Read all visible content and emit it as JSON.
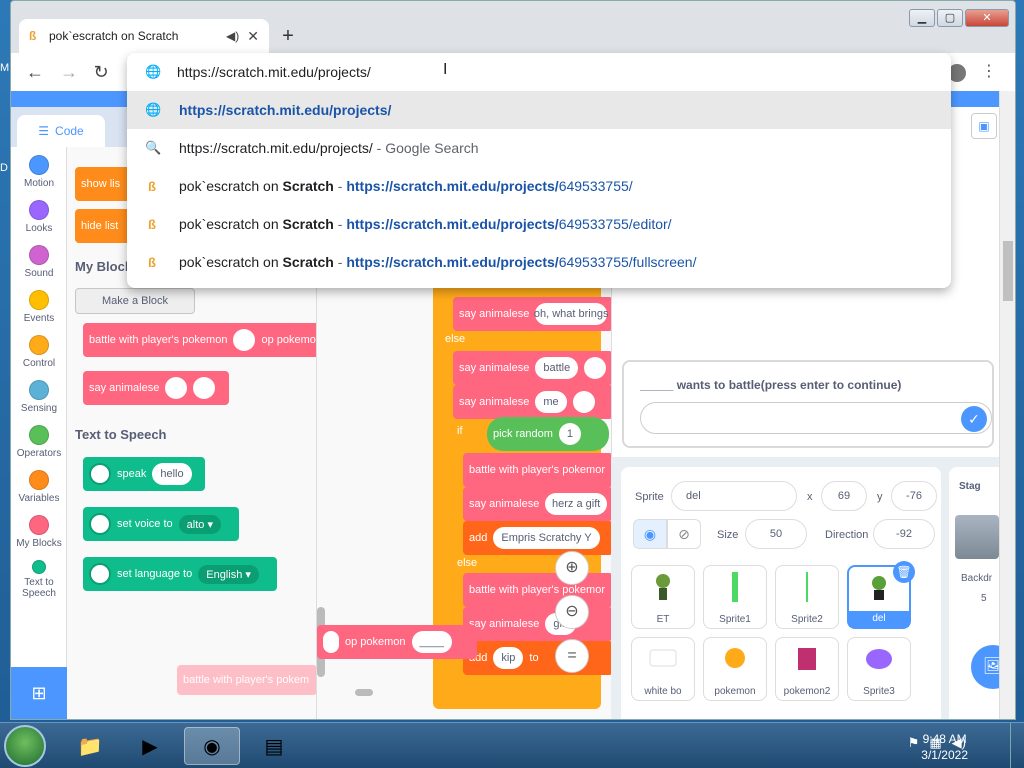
{
  "browser": {
    "tab_title": "pok`escratch on Scratch",
    "new_tab_label": "+",
    "address_value": "https://scratch.mit.edu/projects/",
    "suggestions": [
      {
        "type": "url",
        "text": "https://scratch.mit.edu/projects/"
      },
      {
        "type": "search",
        "text": "https://scratch.mit.edu/projects/",
        "suffix": " - Google Search"
      },
      {
        "type": "history",
        "title_a": "pok`escratch on ",
        "title_b": "Scratch",
        "sep": " - ",
        "url_bold": "https://scratch.mit.edu/projects/",
        "url_rest": "649533755/"
      },
      {
        "type": "history",
        "title_a": "pok`escratch on ",
        "title_b": "Scratch",
        "sep": " - ",
        "url_bold": "https://scratch.mit.edu/projects/",
        "url_rest": "649533755/editor/"
      },
      {
        "type": "history",
        "title_a": "pok`escratch on ",
        "title_b": "Scratch",
        "sep": " - ",
        "url_bold": "https://scratch.mit.edu/projects/",
        "url_rest": "649533755/fullscreen/"
      }
    ]
  },
  "scratch": {
    "code_tab": "Code",
    "categories": [
      "Motion",
      "Looks",
      "Sound",
      "Events",
      "Control",
      "Sensing",
      "Operators",
      "Variables",
      "My Blocks",
      "Text to Speech"
    ],
    "category_colors": [
      "#4c97ff",
      "#9966ff",
      "#cf63cf",
      "#ffbf00",
      "#ffab19",
      "#5cb1d6",
      "#59c059",
      "#ff8c1a",
      "#ff6680",
      "#0fbd8c"
    ],
    "palette": {
      "show_list": "show lis",
      "hide_list": "hide list",
      "my_blocks_title": "My Block",
      "make_block": "Make a Block",
      "battle_block": "battle with player's pokemon",
      "op_pokemon": "op pokemon",
      "say_animalese": "say animalese",
      "tts_title": "Text to Speech",
      "speak": "speak",
      "speak_value": "hello",
      "set_voice": "set voice to",
      "voice_value": "alto",
      "set_language": "set language to",
      "language_value": "English"
    },
    "script": {
      "say1_label": "say animalese",
      "say1_value": "oh, what brings",
      "else1": "else",
      "say2_value": "battle",
      "say3_value": "me",
      "if_label": "if",
      "pick_random": "pick random",
      "pick_value": "1",
      "battle_label": "battle with player's pokemor",
      "say4_value": "herz a gift",
      "add_label": "add",
      "add_value": "Empris Scratchy Y",
      "else2": "else",
      "battle2_label": "battle with player's pokemor",
      "say5_value": "gift",
      "add2_value": "kip",
      "to_label": "to",
      "drag_ghost": "battle with player's pokem",
      "drag_op": "op pokemon"
    },
    "ask_question": "_____ wants to battle(press enter to continue)",
    "sprite_info": {
      "sprite_label": "Sprite",
      "sprite_name": "del",
      "x_label": "x",
      "x_value": "69",
      "y_label": "y",
      "y_value": "-76",
      "size_label": "Size",
      "size_value": "50",
      "direction_label": "Direction",
      "direction_value": "-92"
    },
    "sprites": [
      "ET",
      "Sprite1",
      "Sprite2",
      "del"
    ],
    "sprites_row2": [
      "white bo",
      "pokemon",
      "pokemon2",
      "Sprite3"
    ],
    "stage_label": "Stag",
    "backdrops_label": "Backdr",
    "backdrops_count": "5"
  },
  "taskbar": {
    "time": "9:48 AM",
    "date": "3/1/2022"
  }
}
